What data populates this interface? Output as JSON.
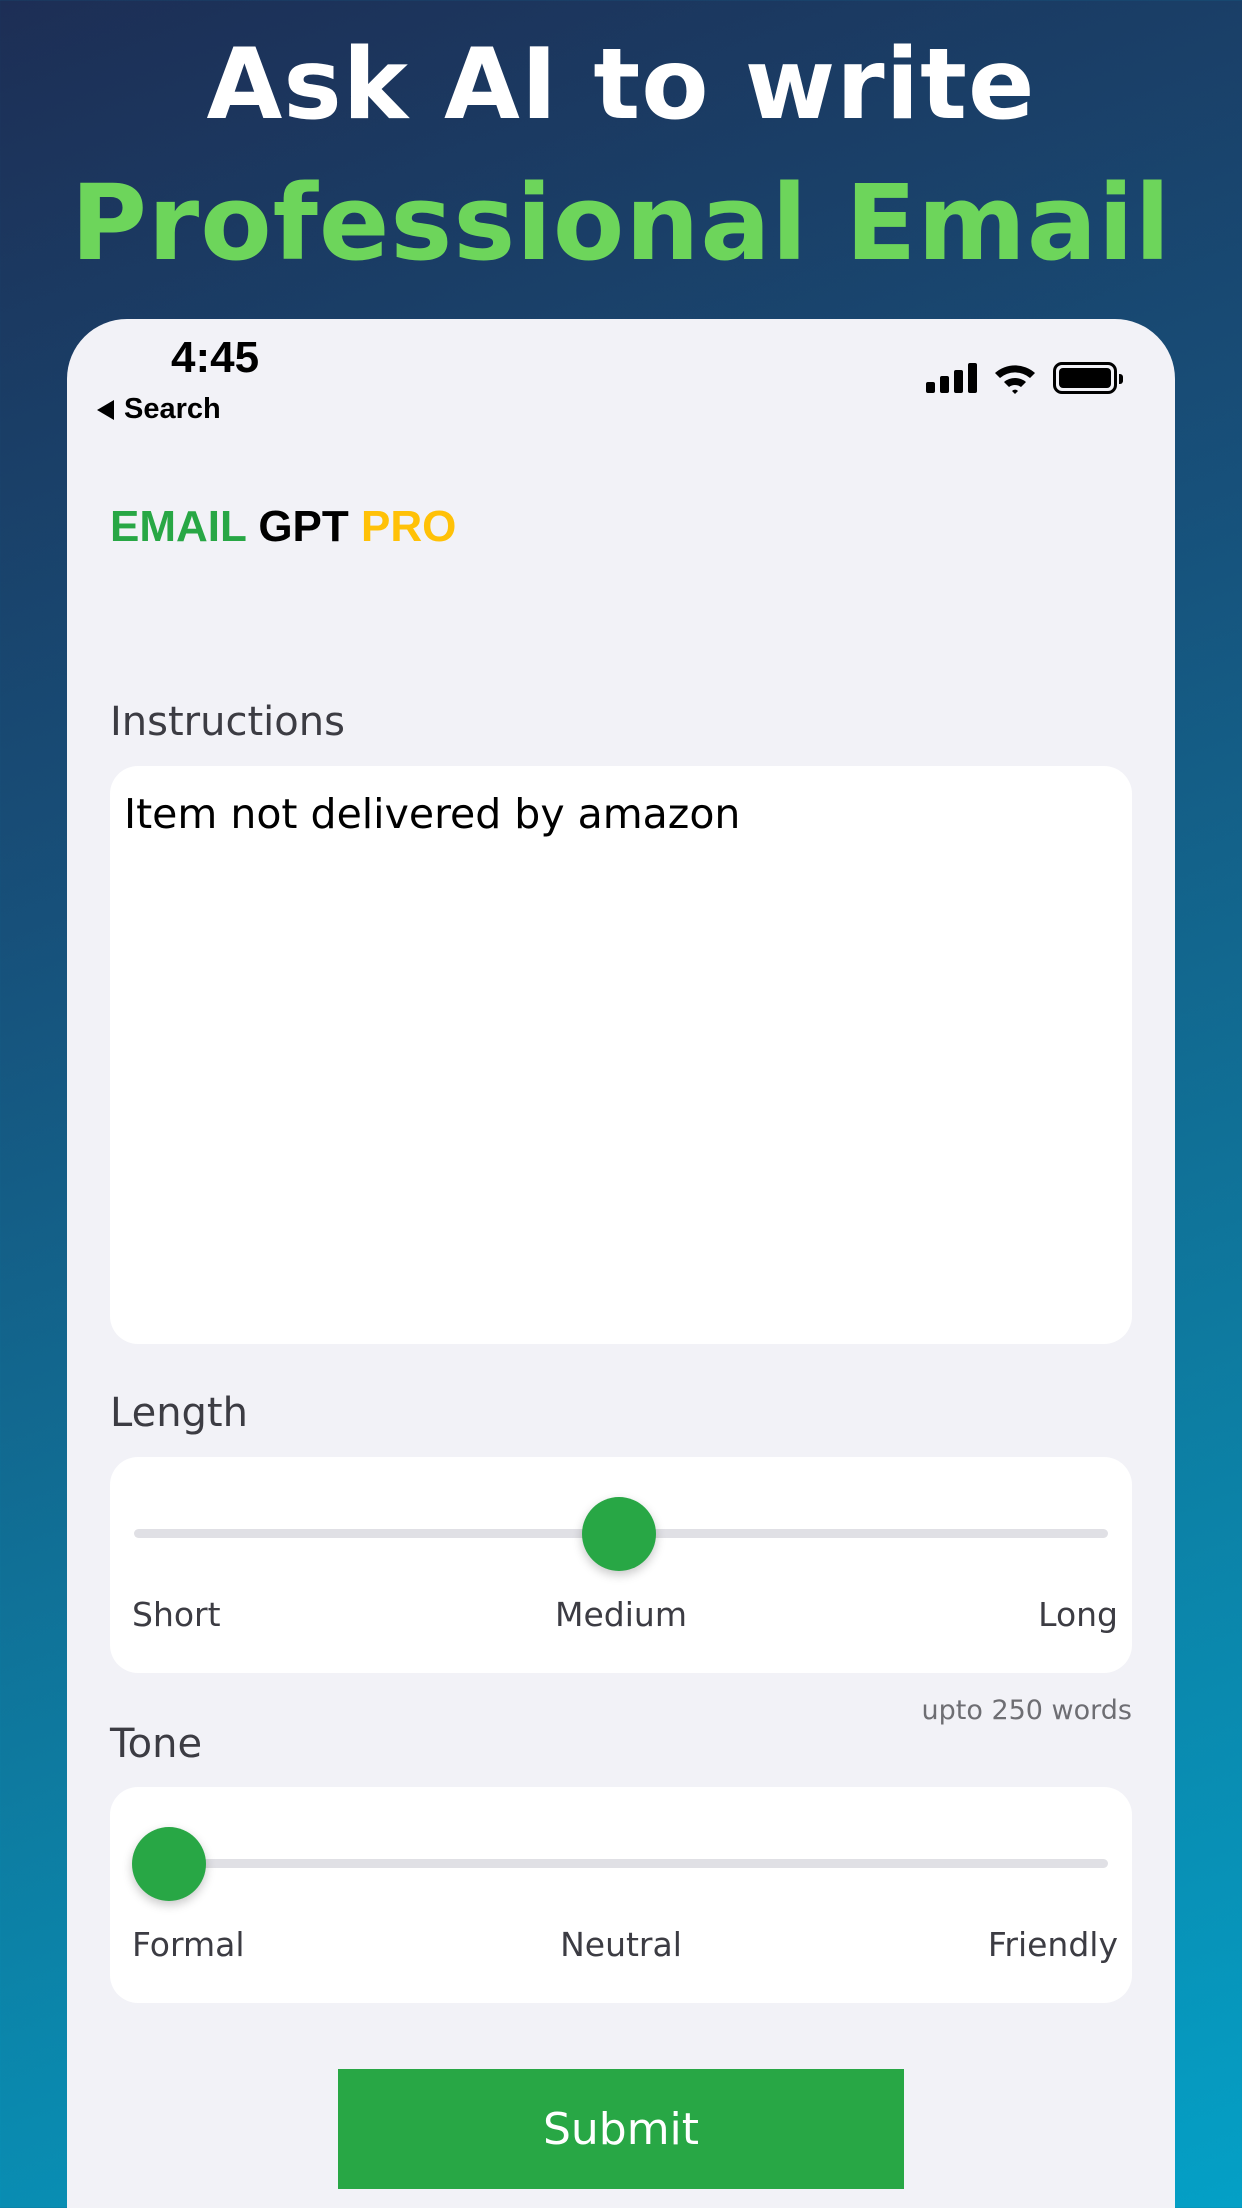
{
  "promo": {
    "line1": "Ask AI to write",
    "line2": "Professional Email",
    "line2_color": "#6dd55b"
  },
  "status_bar": {
    "time": "4:45",
    "back_label": "Search",
    "icons": [
      "cellular-signal-icon",
      "wifi-icon",
      "battery-icon"
    ]
  },
  "app": {
    "title_part1": "EMAIL",
    "title_part2": "GPT",
    "title_part3": "PRO",
    "colors": {
      "part1": "#28a745",
      "part2": "#000000",
      "part3": "#ffc107"
    }
  },
  "instructions": {
    "label": "Instructions",
    "value": "Item not delivered by amazon"
  },
  "length": {
    "label": "Length",
    "stops": [
      "Short",
      "Medium",
      "Long"
    ],
    "selected": "Medium",
    "position": 0.5,
    "helper": "upto 250 words"
  },
  "tone": {
    "label": "Tone",
    "stops": [
      "Formal",
      "Neutral",
      "Friendly"
    ],
    "selected": "Formal",
    "position": 0.0
  },
  "submit": {
    "label": "Submit",
    "color": "#28a745"
  }
}
